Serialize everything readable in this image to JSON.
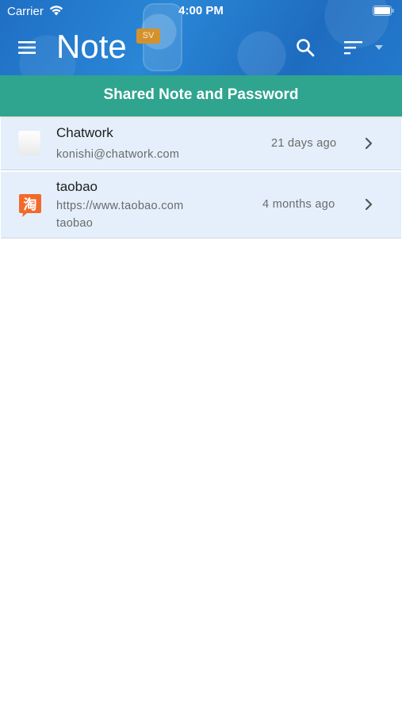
{
  "status_bar": {
    "carrier": "Carrier",
    "time": "4:00 PM"
  },
  "header": {
    "title": "Note",
    "badge": "SV",
    "menu_icon": "hamburger-menu-icon",
    "search_icon": "search-icon",
    "sort_icon": "sort-icon",
    "caret_icon": "caret-down-icon",
    "background_color": "#2379cc"
  },
  "section": {
    "title": "Shared Note and Password",
    "color": "#2fa48e"
  },
  "items": [
    {
      "title": "Chatwork",
      "lines": [
        "konishi@chatwork.com"
      ],
      "date": "21 days ago",
      "icon": "blank-app-icon"
    },
    {
      "title": "taobao",
      "lines": [
        "https://www.taobao.com",
        "taobao"
      ],
      "date": "4 months ago",
      "icon": "taobao-icon",
      "icon_glyph": "淘"
    }
  ]
}
